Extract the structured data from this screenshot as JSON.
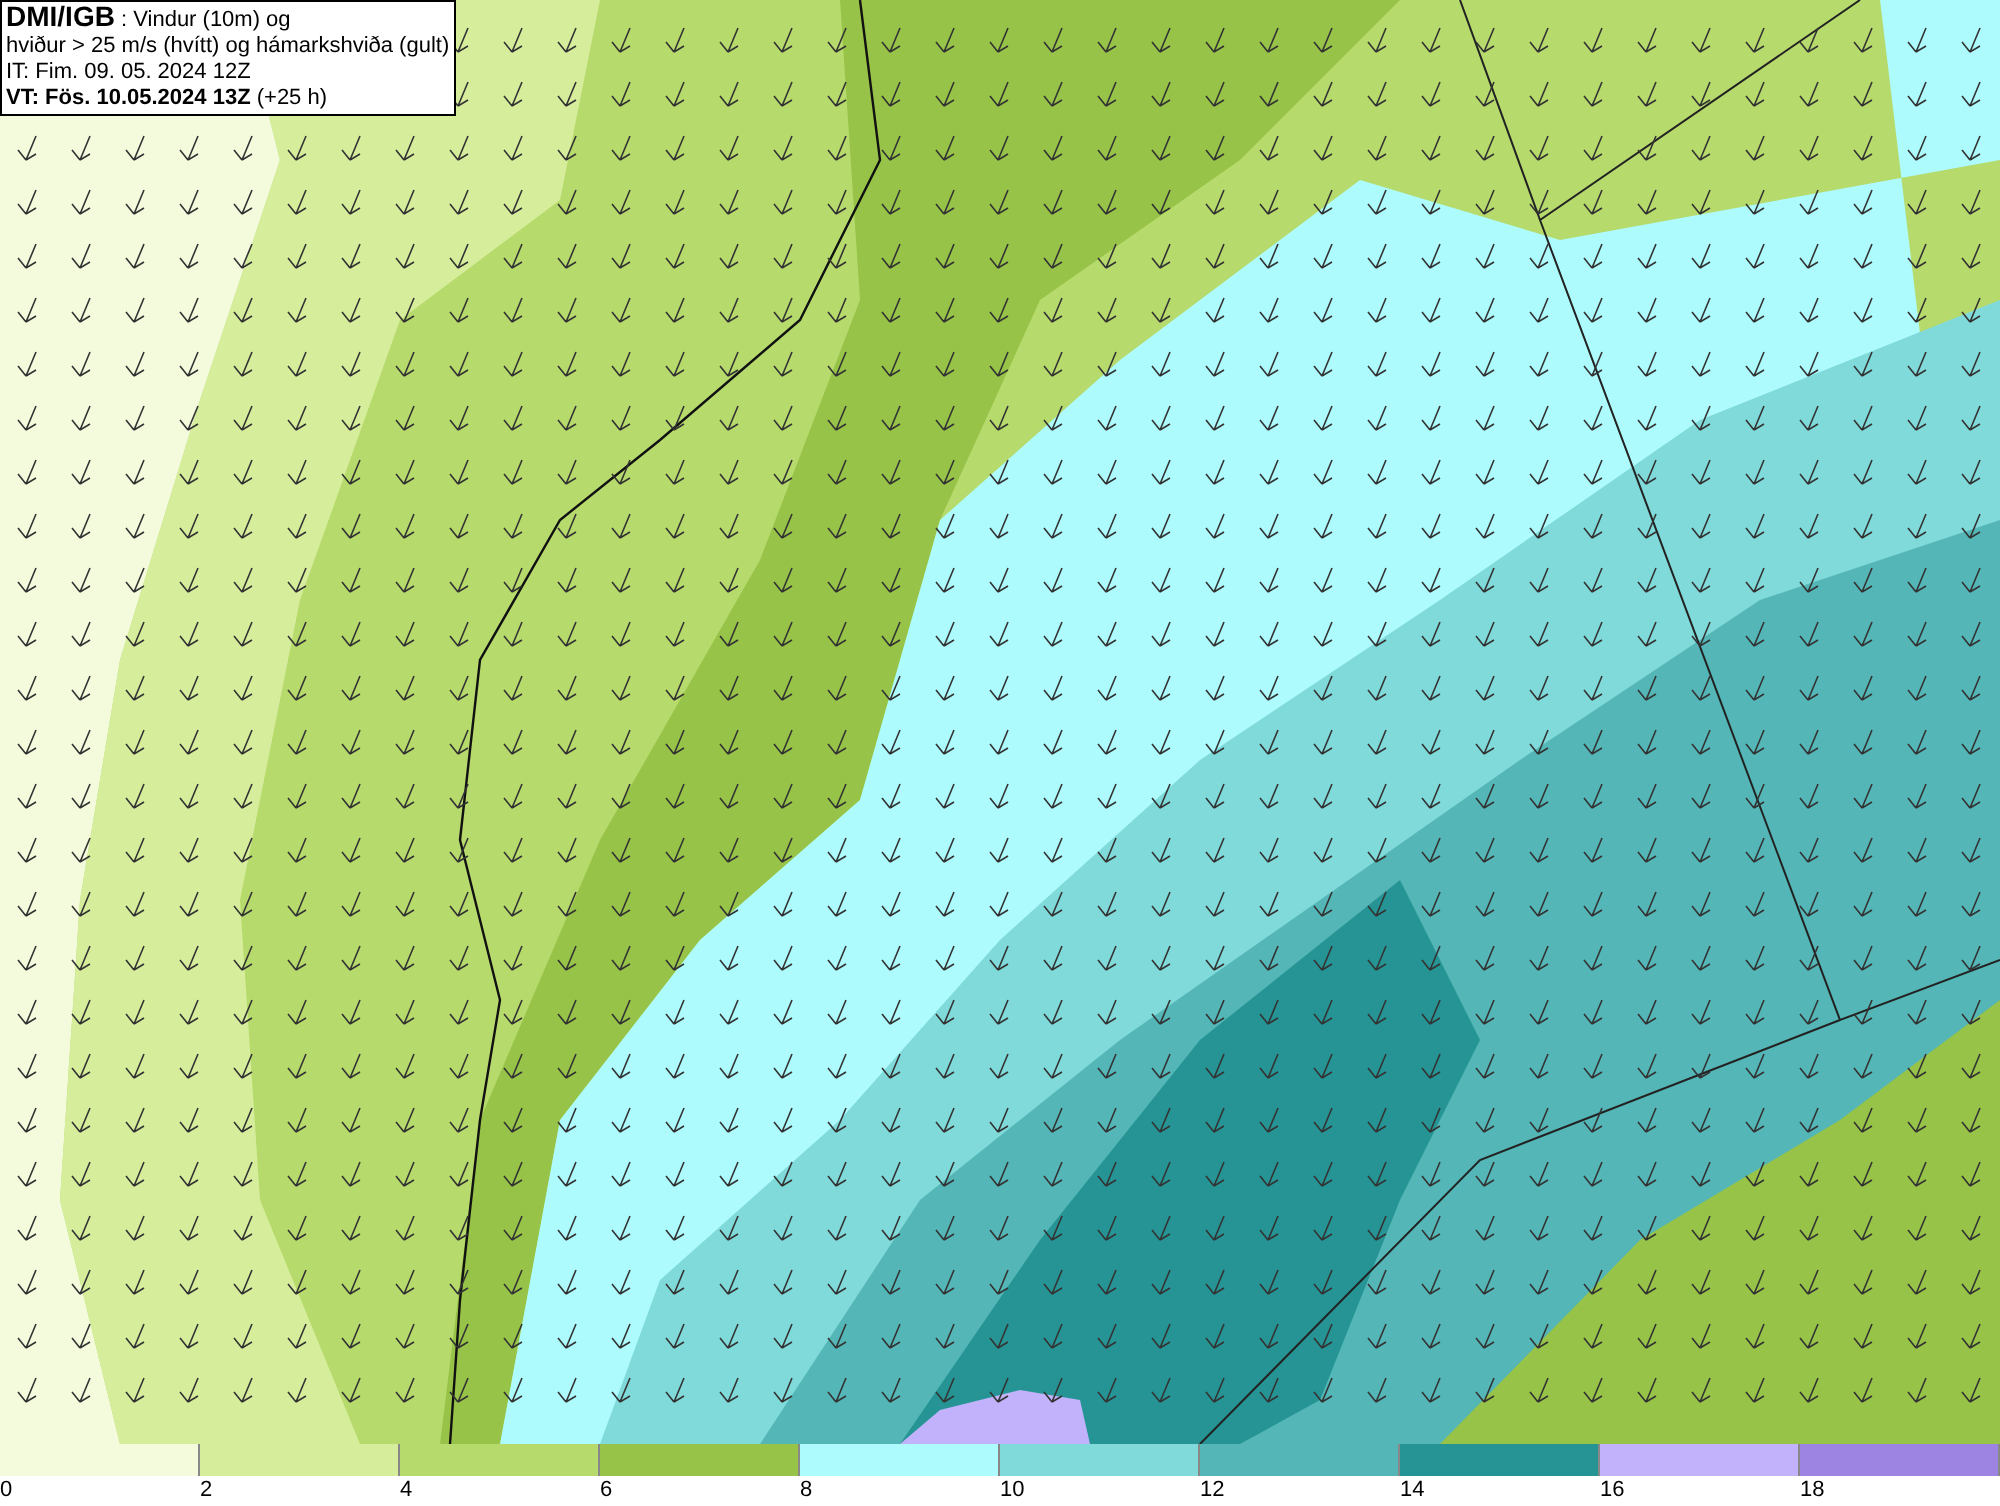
{
  "info_box": {
    "lines": [
      "**DMI/IGB** : Vindur (10m) og",
      "hviður > 25 m/s (hvítt) og hámarkshviða (gult)",
      "IT: Fim. 09. 05. 2024 12Z",
      "**VT: Fös. 10.05.2024 13Z** (+25 h)"
    ]
  },
  "legend": {
    "bins": [
      {
        "label": "0",
        "color": "#f4fbdc"
      },
      {
        "label": "2",
        "color": "#d6ee9c"
      },
      {
        "label": "4",
        "color": "#b6da6c"
      },
      {
        "label": "6",
        "color": "#97c348"
      },
      {
        "label": "8",
        "color": "#adfbfd"
      },
      {
        "label": "10",
        "color": "#80dada"
      },
      {
        "label": "12",
        "color": "#54b6b6"
      },
      {
        "label": "14",
        "color": "#269494"
      },
      {
        "label": "16",
        "color": "#c2b2fb"
      },
      {
        "label": "18",
        "color": "#9e84e2"
      }
    ]
  }
}
